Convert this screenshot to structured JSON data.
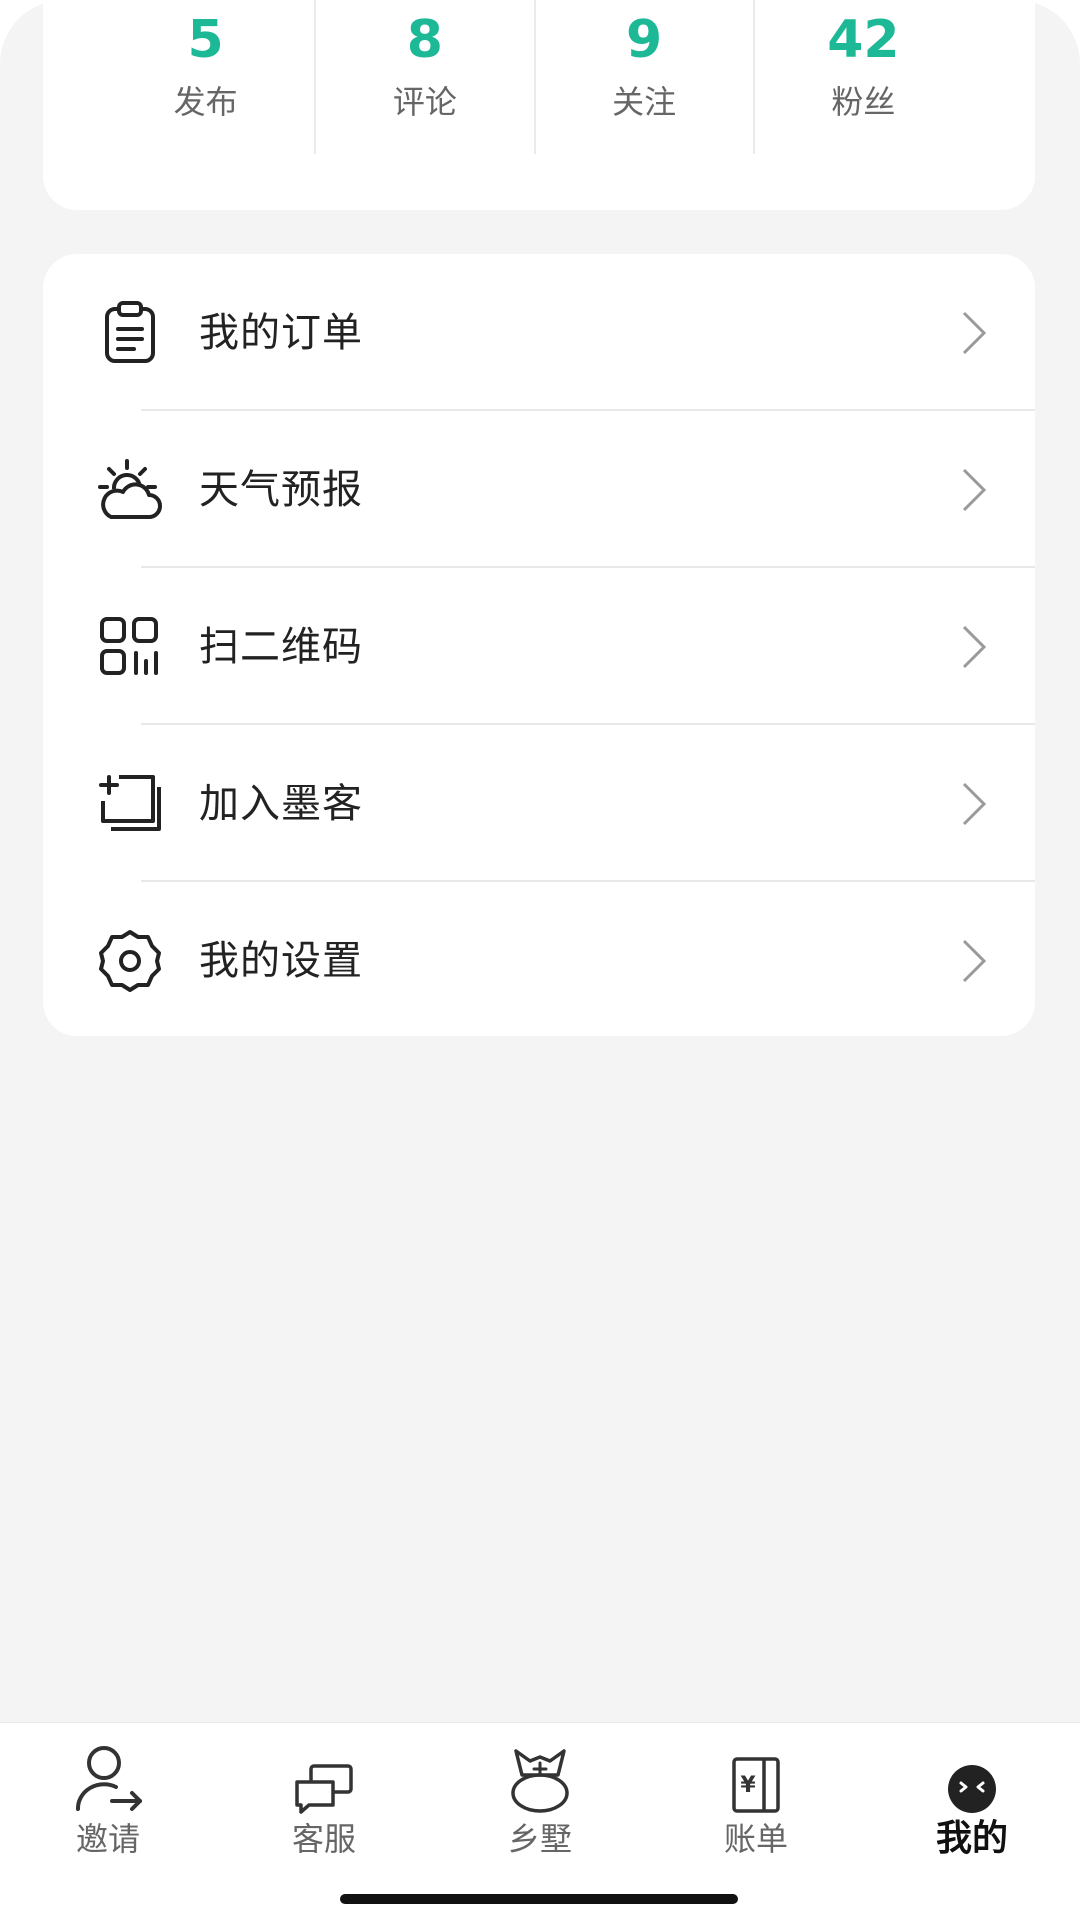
{
  "stats": [
    {
      "value": "5",
      "label": "发布"
    },
    {
      "value": "8",
      "label": "评论"
    },
    {
      "value": "9",
      "label": "关注"
    },
    {
      "value": "42",
      "label": "粉丝"
    }
  ],
  "menu": [
    {
      "label": "我的订单",
      "icon": "clipboard-icon"
    },
    {
      "label": "天气预报",
      "icon": "weather-icon"
    },
    {
      "label": "扫二维码",
      "icon": "qr-code-icon"
    },
    {
      "label": "加入墨客",
      "icon": "add-copy-icon"
    },
    {
      "label": "我的设置",
      "icon": "gear-icon"
    }
  ],
  "tabs": [
    {
      "label": "邀请",
      "icon": "invite-user-icon"
    },
    {
      "label": "客服",
      "icon": "chat-bubbles-icon"
    },
    {
      "label": "乡墅",
      "icon": "village-mascot-icon"
    },
    {
      "label": "账单",
      "icon": "bill-yen-icon"
    },
    {
      "label": "我的",
      "icon": "profile-face-icon",
      "active": true
    }
  ],
  "colors": {
    "accent": "#1db896",
    "background": "#f4f4f4",
    "card": "#ffffff",
    "text": "#222222",
    "muted": "#666666"
  }
}
